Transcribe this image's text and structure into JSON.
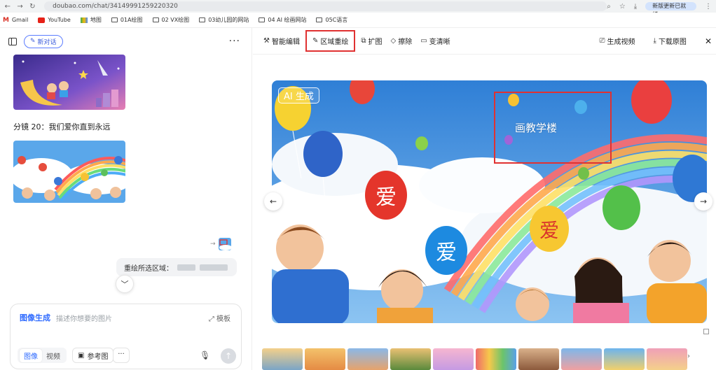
{
  "browser": {
    "address": "doubao.com/chat/34149991259220320",
    "profile_label": "新版更新已就绪",
    "bookmarks": [
      "Gmail",
      "YouTube",
      "地图",
      "01A绘图",
      "02 VX绘图",
      "03幼儿园的网站",
      "04 AI 绘画网站",
      "05C语言"
    ]
  },
  "left_panel": {
    "new_chat_label": "新对话",
    "caption": "分镜 20：我们爱你直到永远",
    "user_message_prefix": "重绘所选区域：",
    "input": {
      "mode_label": "图像生成",
      "placeholder": "描述你想要的图片",
      "template_label": "模板",
      "seg_image": "图像",
      "seg_video": "视频",
      "reference_label": "参考图",
      "more_label": "···"
    }
  },
  "viewer": {
    "tools": [
      {
        "label": "智能编辑",
        "icon": "magic-wand-icon"
      },
      {
        "label": "区域重绘",
        "icon": "brush-icon",
        "highlighted": true
      },
      {
        "label": "扩图",
        "icon": "expand-icon"
      },
      {
        "label": "擦除",
        "icon": "eraser-icon"
      },
      {
        "label": "变清晰",
        "icon": "hd-icon"
      }
    ],
    "generate_video_label": "生成视频",
    "download_label": "下载原图",
    "ai_badge": "AI 生成",
    "selection_text": "画教学楼",
    "balloon_text": "爱"
  },
  "colors": {
    "accent": "#2f6bff",
    "highlight": "#e03131"
  }
}
